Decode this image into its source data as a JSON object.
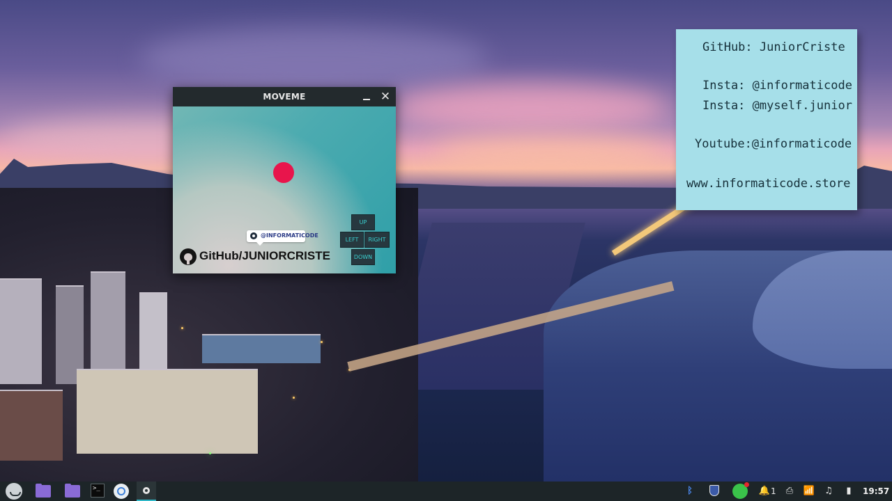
{
  "window": {
    "title": "MOVEME",
    "close_glyph": "✕",
    "watermark_handle": "@INFORMATICODE",
    "watermark_github": "GitHub/JUNIORCRISTE",
    "controls": {
      "up": "UP",
      "left": "LEFT",
      "right": "RIGHT",
      "down": "DOWN"
    },
    "ball_color": "#e8154c"
  },
  "sticky_note": {
    "lines": [
      "GitHub: JuniorCriste",
      "Insta: @informaticode",
      "Insta: @myself.junior",
      "Youtube:@informaticode",
      "www.informaticode.store"
    ],
    "background": "#a6dfe9"
  },
  "taskbar": {
    "apps": [
      "menu-launcher",
      "file-manager",
      "file-manager",
      "terminal",
      "browser",
      "settings"
    ],
    "terminal_glyph": ">_",
    "tray": {
      "bluetooth_glyph": "ᛒ",
      "notification_count": "1",
      "printer_glyph": "⎙",
      "wifi_glyph": "📶",
      "music_glyph": "♫",
      "battery_glyph": "▮",
      "notif_glyph": "🔔"
    },
    "clock": "19:57"
  }
}
